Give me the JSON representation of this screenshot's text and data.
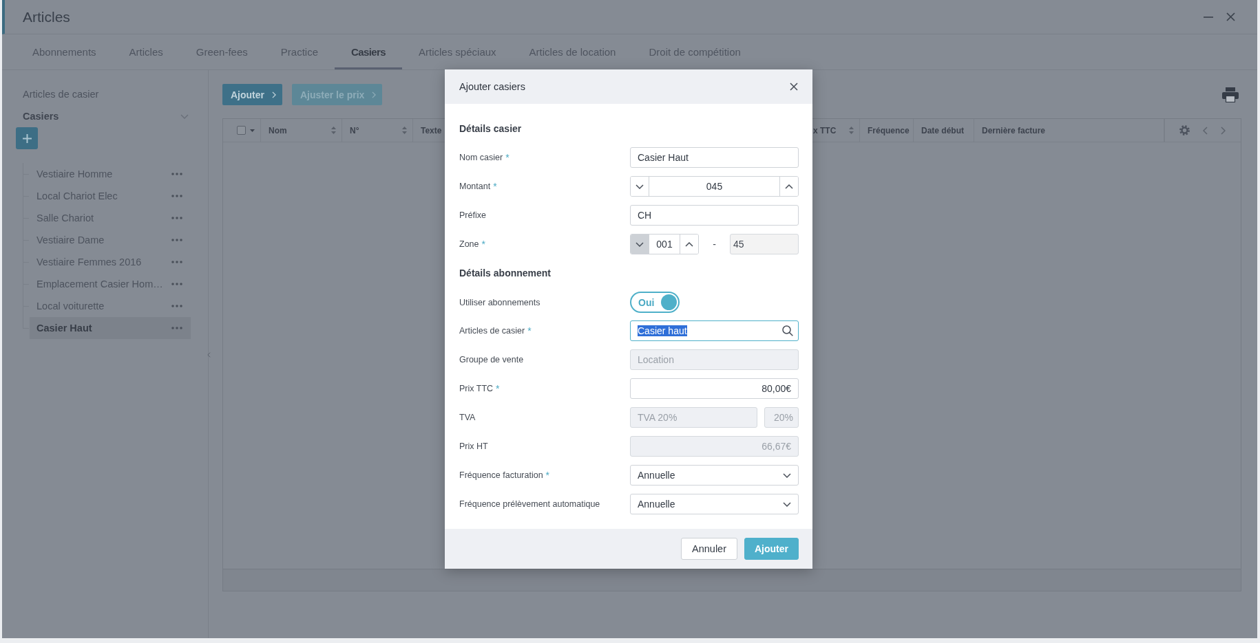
{
  "window": {
    "title": "Articles"
  },
  "tabs": [
    {
      "label": "Abonnements",
      "selected": false
    },
    {
      "label": "Articles",
      "selected": false
    },
    {
      "label": "Green-fees",
      "selected": false
    },
    {
      "label": "Practice",
      "selected": false
    },
    {
      "label": "Casiers",
      "selected": true
    },
    {
      "label": "Articles spéciaux",
      "selected": false
    },
    {
      "label": "Articles de location",
      "selected": false
    },
    {
      "label": "Droit de compétition",
      "selected": false
    }
  ],
  "sidebar": {
    "heading": "Articles de casier",
    "group": {
      "label": "Casiers",
      "expanded": true
    },
    "items": [
      {
        "label": "Vestiaire Homme",
        "selected": false
      },
      {
        "label": "Local Chariot Elec",
        "selected": false
      },
      {
        "label": "Salle Chariot",
        "selected": false
      },
      {
        "label": "Vestiaire Dame",
        "selected": false
      },
      {
        "label": "Vestiaire Femmes 2016",
        "selected": false
      },
      {
        "label": "Emplacement Casier Hom…",
        "selected": false
      },
      {
        "label": "Local voiturette",
        "selected": false
      },
      {
        "label": "Casier Haut",
        "selected": true
      }
    ]
  },
  "toolbar": {
    "buttons": [
      {
        "label": "Ajouter",
        "disabled": false
      },
      {
        "label": "Ajuster le prix",
        "disabled": true
      }
    ]
  },
  "table": {
    "select_all": {
      "checked": false
    },
    "columns": [
      {
        "label": "Nom",
        "sortable": true
      },
      {
        "label": "N°",
        "sortable": true
      },
      {
        "label": "Texte",
        "sortable": false
      },
      {
        "label": "x TTC",
        "sortable": true
      },
      {
        "label": "Fréquence",
        "sortable": false
      },
      {
        "label": "Date début",
        "sortable": false
      },
      {
        "label": "Dernière facture",
        "sortable": false
      }
    ]
  },
  "dialog": {
    "title": "Ajouter casiers",
    "sections": [
      {
        "heading": "Détails casier",
        "fields": [
          {
            "kind": "text",
            "label": "Nom casier",
            "required_mark": "*",
            "value": "Casier Haut",
            "disabled": false
          },
          {
            "kind": "stepper",
            "label": "Montant",
            "required_mark": "*",
            "value": "045",
            "decrement_disabled": false
          },
          {
            "kind": "text",
            "label": "Préfixe",
            "value": "CH",
            "disabled": false
          },
          {
            "kind": "zone",
            "label": "Zone",
            "required_mark": "*",
            "value": "001",
            "decrement_disabled": true,
            "separator": "-",
            "end_value": "45",
            "end_disabled": true
          }
        ]
      },
      {
        "heading": "Détails abonnement",
        "fields": [
          {
            "kind": "toggle",
            "label": "Utiliser abonnements",
            "on": true,
            "text": "Oui"
          },
          {
            "kind": "search",
            "label": "Articles de casier",
            "required_mark": "*",
            "value": "Casier haut",
            "focused": true,
            "value_selected": true
          },
          {
            "kind": "text",
            "label": "Groupe de vente",
            "value": "Location",
            "disabled": true
          },
          {
            "kind": "amount",
            "label": "Prix TTC",
            "required_mark": "*",
            "value": "80,00€",
            "disabled": false
          },
          {
            "kind": "tax",
            "label": "TVA",
            "value": "TVA 20%",
            "rate": "20%",
            "disabled": true
          },
          {
            "kind": "amount",
            "label": "Prix HT",
            "value": "66,67€",
            "disabled": true
          },
          {
            "kind": "select",
            "label": "Fréquence facturation",
            "required_mark": "*",
            "value": "Annuelle",
            "disabled": false
          },
          {
            "kind": "select",
            "label": "Fréquence prélèvement automatique",
            "value": "Annuelle",
            "disabled": false
          }
        ]
      }
    ],
    "buttons": [
      {
        "label": "Annuler",
        "primary": false
      },
      {
        "label": "Ajouter",
        "primary": true
      }
    ]
  }
}
